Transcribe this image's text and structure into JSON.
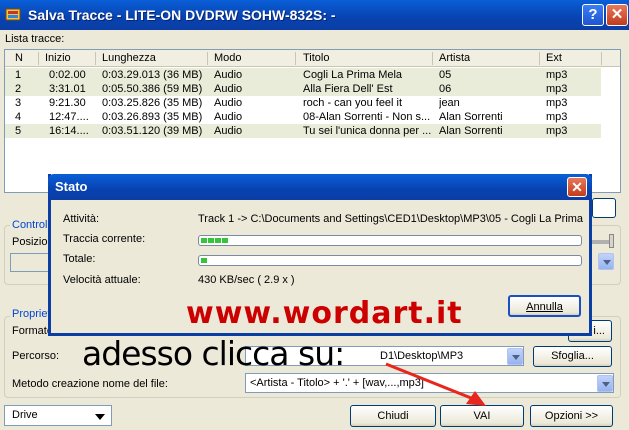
{
  "window": {
    "title": "Salva Tracce - LITE-ON  DVDRW SOHW-832S:    -",
    "help_label": "?",
    "close_label": "✕"
  },
  "tracklist": {
    "label": "Lista tracce:",
    "columns": [
      "N",
      "Inizio",
      "Lunghezza",
      "Modo",
      "Titolo",
      "Artista",
      "Ext"
    ],
    "rows": [
      {
        "n": "1",
        "inizio": "0:02.00",
        "lunghezza": "0:03.29.013 (36 MB)",
        "modo": "Audio",
        "titolo": "Cogli La Prima Mela",
        "artista": "05",
        "ext": "mp3"
      },
      {
        "n": "2",
        "inizio": "3:31.01",
        "lunghezza": "0:05.50.386 (59 MB)",
        "modo": "Audio",
        "titolo": "Alla Fiera Dell' Est",
        "artista": "06",
        "ext": "mp3"
      },
      {
        "n": "3",
        "inizio": "9:21.30",
        "lunghezza": "0:03.25.826 (35 MB)",
        "modo": "Audio",
        "titolo": "roch - can you feel it",
        "artista": "jean",
        "ext": "mp3"
      },
      {
        "n": "4",
        "inizio": "12:47....",
        "lunghezza": "0:03.26.893 (35 MB)",
        "modo": "Audio",
        "titolo": "08-Alan Sorrenti - Non s...",
        "artista": "Alan Sorrenti",
        "ext": "mp3"
      },
      {
        "n": "5",
        "inizio": "16:14....",
        "lunghezza": "0:03.51.120 (39 MB)",
        "modo": "Audio",
        "titolo": "Tu sei l'unica donna per ...",
        "artista": "Alan Sorrenti",
        "ext": "mp3"
      }
    ]
  },
  "background": {
    "controlli_label": "Controll",
    "posizione_label": "Posizion",
    "proprieta_label": "Propriet",
    "formato_label": "Formato",
    "formato_button_fragment": "i...",
    "percorso_label": "Percorso:",
    "percorso_value": "D1\\Desktop\\MP3",
    "sfoglia_button": "Sfoglia...",
    "metodo_label": "Metodo creazione nome del file:",
    "metodo_value": "<Artista - Titolo> + '.' + [wav,...,mp3]",
    "drive_value": "Drive",
    "chiudi_button": "Chiudi",
    "vai_button": "VAI",
    "opzioni_button": "Opzioni >>"
  },
  "dialog": {
    "title": "Stato",
    "close_label": "✕",
    "attivita_label": "Attività:",
    "attivita_value": "Track 1 -> C:\\Documents and Settings\\CED1\\Desktop\\MP3\\05 - Cogli La Prima",
    "traccia_label": "Traccia corrente:",
    "traccia_progress": 0.07,
    "totale_label": "Totale:",
    "totale_progress": 0.02,
    "velocita_label": "Velocità attuale:",
    "velocita_value": "430 KB/sec ( 2.9 x )",
    "annulla_button": "Annulla"
  },
  "overlay": {
    "wordart": "www.wordart.it",
    "caption": "adesso clicca su:",
    "arrow_color": "#e8261c"
  }
}
